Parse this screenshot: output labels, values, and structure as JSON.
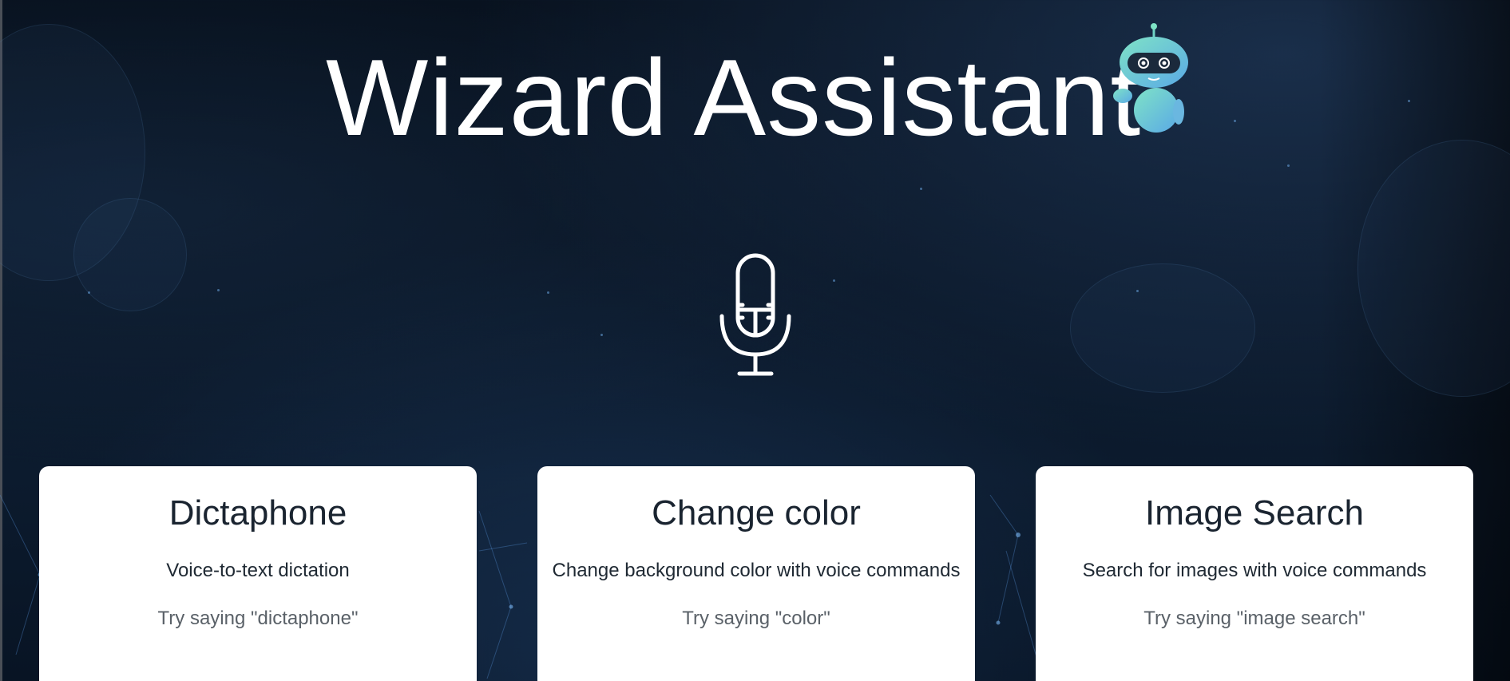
{
  "app": {
    "title": "Wizard Assistant"
  },
  "icons": {
    "robot": "robot-mascot-icon",
    "microphone": "microphone-icon"
  },
  "cards": [
    {
      "title": "Dictaphone",
      "description": "Voice-to-text dictation",
      "hint": "Try saying \"dictaphone\""
    },
    {
      "title": "Change color",
      "description": "Change background color with voice commands",
      "hint": "Try saying \"color\""
    },
    {
      "title": "Image Search",
      "description": "Search for images with voice commands",
      "hint": "Try saying \"image search\""
    }
  ],
  "colors": {
    "background": "#0a1626",
    "title_text": "#ffffff",
    "card_background": "#ffffff",
    "card_title": "#1a2430",
    "card_hint": "#5a6168",
    "robot_accent": "#5fd6d0"
  }
}
